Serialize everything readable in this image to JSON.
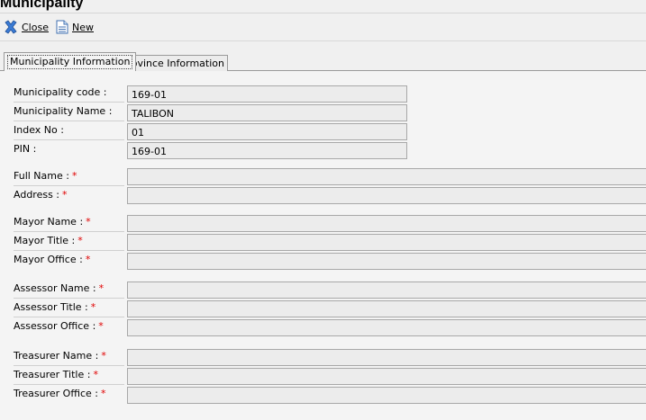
{
  "window": {
    "title": "Municipality"
  },
  "toolbar": {
    "close_label": "Close",
    "new_label": "New"
  },
  "tabs": [
    {
      "label": "Municipality Information",
      "active": true
    },
    {
      "label": "Province Information",
      "active": false
    }
  ],
  "info": {
    "municipality_code": {
      "label": "Municipality code :",
      "value": "169-01"
    },
    "municipality_name": {
      "label": "Municipality Name :",
      "value": "TALIBON"
    },
    "index_no": {
      "label": "Index No :",
      "value": "01"
    },
    "pin": {
      "label": "PIN :",
      "value": "169-01"
    }
  },
  "form": {
    "required_mark": "*",
    "full_name": {
      "label": "Full Name :",
      "value": ""
    },
    "address": {
      "label": "Address :",
      "value": ""
    },
    "mayor_name": {
      "label": "Mayor Name :",
      "value": ""
    },
    "mayor_title": {
      "label": "Mayor Title :",
      "value": ""
    },
    "mayor_office": {
      "label": "Mayor Office :",
      "value": ""
    },
    "assessor_name": {
      "label": "Assessor Name :",
      "value": ""
    },
    "assessor_title": {
      "label": "Assessor Title :",
      "value": ""
    },
    "assessor_office": {
      "label": "Assessor Office :",
      "value": ""
    },
    "treasurer_name": {
      "label": "Treasurer Name :",
      "value": ""
    },
    "treasurer_title": {
      "label": "Treasurer Title :",
      "value": ""
    },
    "treasurer_office": {
      "label": "Treasurer Office :",
      "value": ""
    }
  },
  "colors": {
    "required": "#e00000",
    "close_icon": "#2f6fbf",
    "field_bg": "#ececec"
  },
  "icons": {
    "close": "close-x-icon",
    "new": "new-document-icon"
  }
}
